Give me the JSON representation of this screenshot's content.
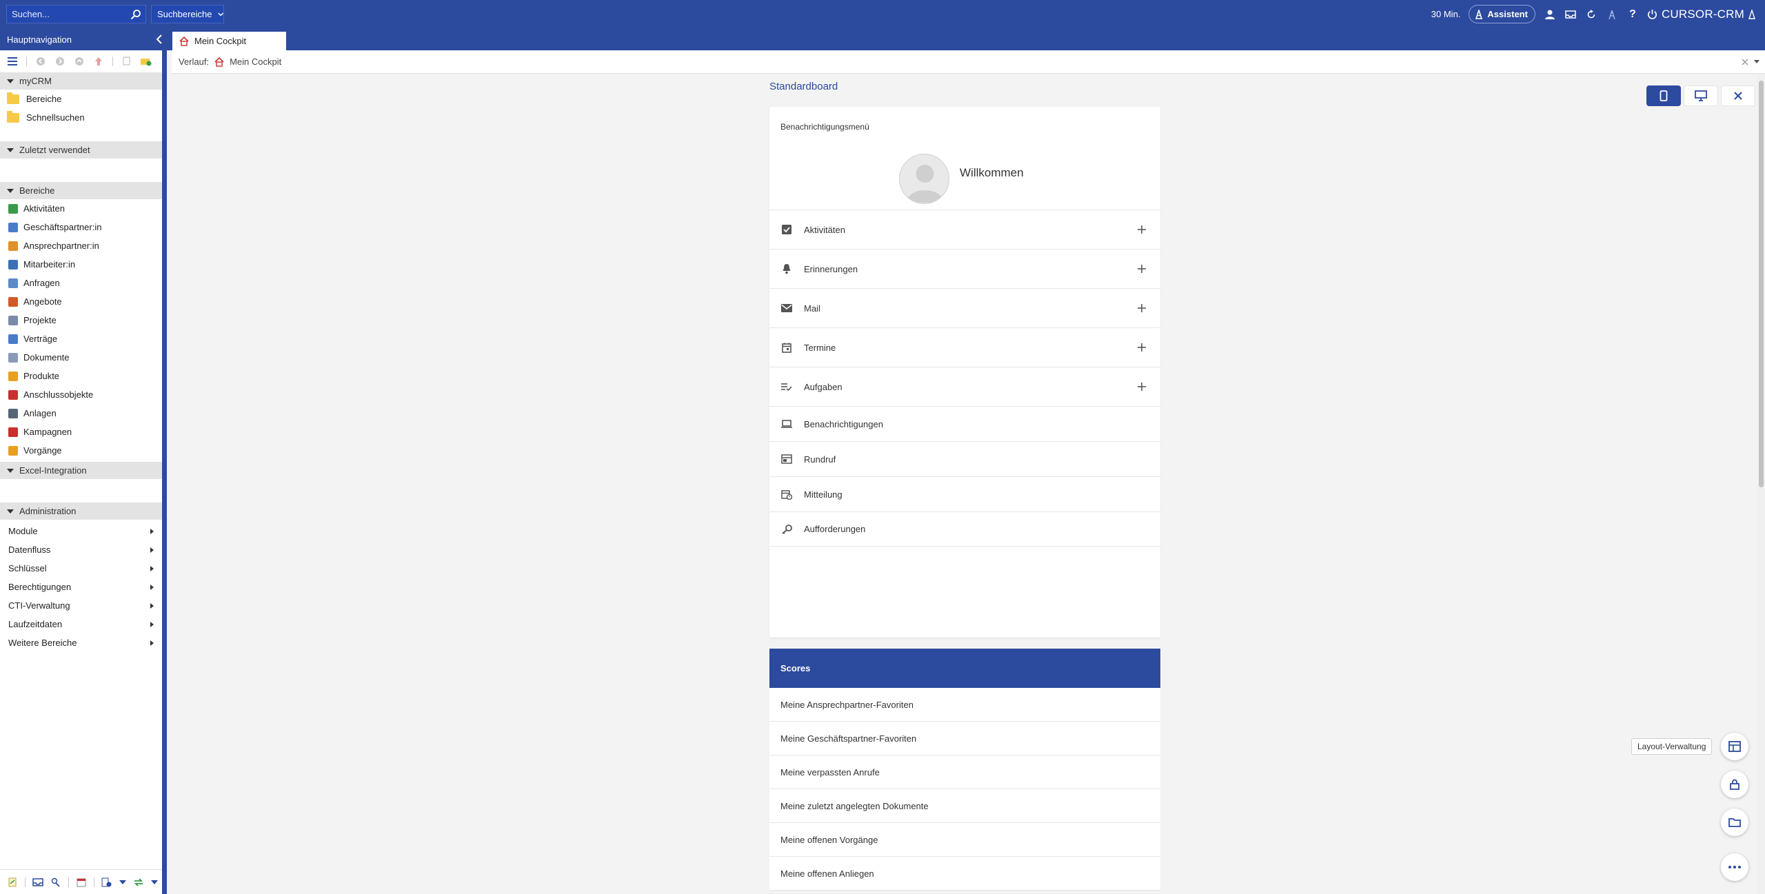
{
  "topbar": {
    "search_placeholder": "Suchen...",
    "scope_label": "Suchbereiche",
    "timer": "30 Min.",
    "assistant_label": "Assistent",
    "brand": "CURSOR-CRM"
  },
  "tabs": {
    "nav_title": "Hauptnavigation",
    "active_tab": "Mein Cockpit"
  },
  "breadcrumb": {
    "label": "Verlauf:",
    "item": "Mein Cockpit"
  },
  "sidebar": {
    "mycrm": {
      "title": "myCRM",
      "items": [
        "Bereiche",
        "Schnellsuchen"
      ]
    },
    "recent_title": "Zuletzt verwendet",
    "bereiche": {
      "title": "Bereiche",
      "items": [
        {
          "label": "Aktivitäten",
          "color": "#3a9a4a"
        },
        {
          "label": "Geschäftspartner:in",
          "color": "#4a7bc8"
        },
        {
          "label": "Ansprechpartner:in",
          "color": "#e0902a"
        },
        {
          "label": "Mitarbeiter:in",
          "color": "#3c6fb5"
        },
        {
          "label": "Anfragen",
          "color": "#5a8ac8"
        },
        {
          "label": "Angebote",
          "color": "#d25a2a"
        },
        {
          "label": "Projekte",
          "color": "#7a8aa8"
        },
        {
          "label": "Verträge",
          "color": "#4a7bc8"
        },
        {
          "label": "Dokumente",
          "color": "#8a9ab8"
        },
        {
          "label": "Produkte",
          "color": "#e8a020"
        },
        {
          "label": "Anschlussobjekte",
          "color": "#c83030"
        },
        {
          "label": "Anlagen",
          "color": "#556677"
        },
        {
          "label": "Kampagnen",
          "color": "#c83030"
        },
        {
          "label": "Vorgänge",
          "color": "#e8a020"
        }
      ]
    },
    "excel_title": "Excel-Integration",
    "administration": {
      "title": "Administration",
      "items": [
        "Module",
        "Datenfluss",
        "Schlüssel",
        "Berechtigungen",
        "CTI-Verwaltung",
        "Laufzeitdaten",
        "Weitere Bereiche"
      ]
    }
  },
  "main": {
    "board_title": "Standardboard",
    "card_title": "Benachrichtigungsmenü",
    "welcome": "Willkommen",
    "rows": [
      {
        "label": "Aktivitäten",
        "icon": "checkbox-icon",
        "plus": true
      },
      {
        "label": "Erinnerungen",
        "icon": "bell-icon",
        "plus": true
      },
      {
        "label": "Mail",
        "icon": "mail-icon",
        "plus": true
      },
      {
        "label": "Termine",
        "icon": "calendar-icon",
        "plus": true
      },
      {
        "label": "Aufgaben",
        "icon": "tasks-icon",
        "plus": true
      },
      {
        "label": "Benachrichtigungen",
        "icon": "laptop-icon",
        "plus": false
      },
      {
        "label": "Rundruf",
        "icon": "broadcast-icon",
        "plus": false
      },
      {
        "label": "Mitteilung",
        "icon": "message-icon",
        "plus": false
      },
      {
        "label": "Aufforderungen",
        "icon": "key-icon",
        "plus": false
      }
    ],
    "scores_title": "Scores",
    "scores": [
      "Meine Ansprechpartner-Favoriten",
      "Meine Geschäftspartner-Favoriten",
      "Meine verpassten Anrufe",
      "Meine zuletzt angelegten Dokumente",
      "Meine offenen Vorgänge",
      "Meine offenen Anliegen"
    ]
  },
  "floating": {
    "tooltip": "Layout-Verwaltung"
  },
  "colors": {
    "primary": "#2c4a9e",
    "accent_search": "#2348b0"
  }
}
